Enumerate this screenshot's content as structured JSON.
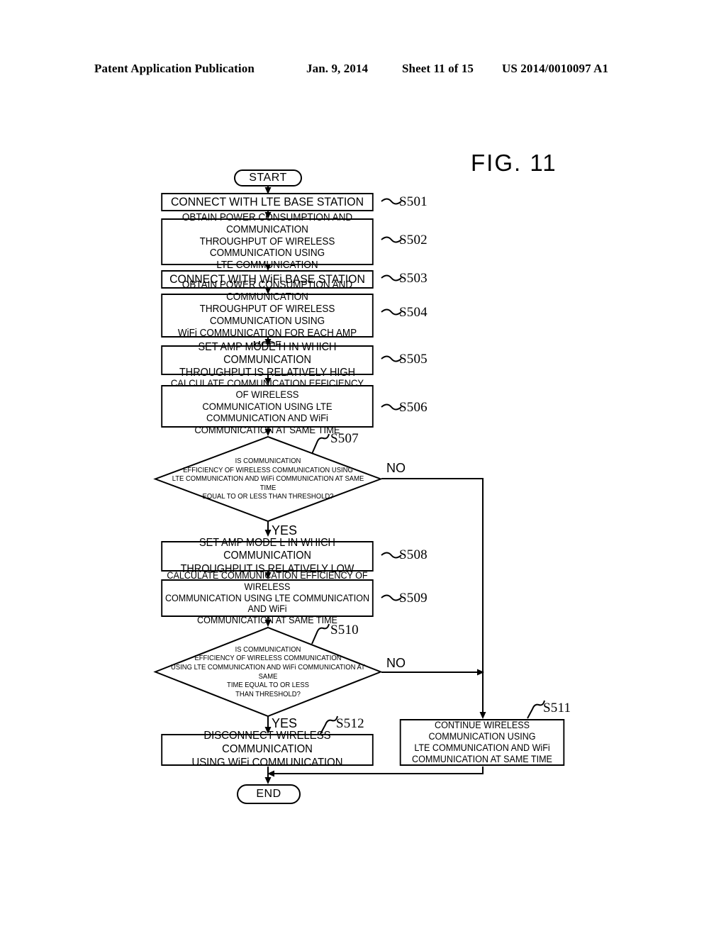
{
  "header": {
    "publication": "Patent Application Publication",
    "date": "Jan. 9, 2014",
    "sheet": "Sheet 11 of 15",
    "patent_number": "US 2014/0010097 A1"
  },
  "figure": {
    "label": "FIG. 11"
  },
  "flowchart": {
    "start_label": "START",
    "end_label": "END",
    "branch_yes": "YES",
    "branch_no": "NO",
    "steps": [
      {
        "id": "S501",
        "ref": "S501",
        "type": "process",
        "text": "CONNECT WITH LTE BASE STATION"
      },
      {
        "id": "S502",
        "ref": "S502",
        "type": "process",
        "text": "OBTAIN POWER CONSUMPTION AND COMMUNICATION\nTHROUGHPUT OF WIRELESS COMMUNICATION USING\nLTE COMMUNICATION"
      },
      {
        "id": "S503",
        "ref": "S503",
        "type": "process",
        "text": "CONNECT WITH WiFi BASE STATION"
      },
      {
        "id": "S504",
        "ref": "S504",
        "type": "process",
        "text": "OBTAIN POWER CONSUMPTION AND COMMUNICATION\nTHROUGHPUT OF WIRELESS COMMUNICATION USING\nWiFi COMMUNICATION FOR EACH AMP MODE"
      },
      {
        "id": "S505",
        "ref": "S505",
        "type": "process",
        "text": "SET AMP MODE H IN WHICH COMMUNICATION\nTHROUGHPUT IS RELATIVELY HIGH"
      },
      {
        "id": "S506",
        "ref": "S506",
        "type": "process",
        "text": "CALCULATE COMMUNICATION EFFICIENCY OF WIRELESS\nCOMMUNICATION USING LTE COMMUNICATION AND WiFi\nCOMMUNICATION AT SAME TIME"
      },
      {
        "id": "S507",
        "ref": "S507",
        "type": "decision",
        "text": "IS COMMUNICATION\nEFFICIENCY OF WIRELESS COMMUNICATION USING\nLTE COMMUNICATION AND WiFi COMMUNICATION AT SAME TIME\nEQUAL TO OR LESS THAN THRESHOLD?"
      },
      {
        "id": "S508",
        "ref": "S508",
        "type": "process",
        "text": "SET AMP MODE L IN WHICH COMMUNICATION\nTHROUGHPUT IS RELATIVELY LOW"
      },
      {
        "id": "S509",
        "ref": "S509",
        "type": "process",
        "text": "CALCULATE COMMUNICATION EFFICIENCY OF WIRELESS\nCOMMUNICATION USING LTE COMMUNICATION AND WiFi\nCOMMUNICATION AT SAME TIME"
      },
      {
        "id": "S510",
        "ref": "S510",
        "type": "decision",
        "text": "IS COMMUNICATION\nEFFICIENCY OF WIRELESS COMMUNICATION\nUSING LTE COMMUNICATION AND WiFi COMMUNICATION AT SAME\nTIME EQUAL TO OR LESS\nTHAN THRESHOLD?"
      },
      {
        "id": "S511",
        "ref": "S511",
        "type": "process",
        "text": "CONTINUE WIRELESS COMMUNICATION USING\nLTE COMMUNICATION AND WiFi\nCOMMUNICATION AT SAME TIME"
      },
      {
        "id": "S512",
        "ref": "S512",
        "type": "process",
        "text": "DISCONNECT WIRELESS COMMUNICATION\nUSING WiFi COMMUNICATION"
      }
    ]
  },
  "colors": {
    "ink": "#000000",
    "paper": "#ffffff"
  }
}
